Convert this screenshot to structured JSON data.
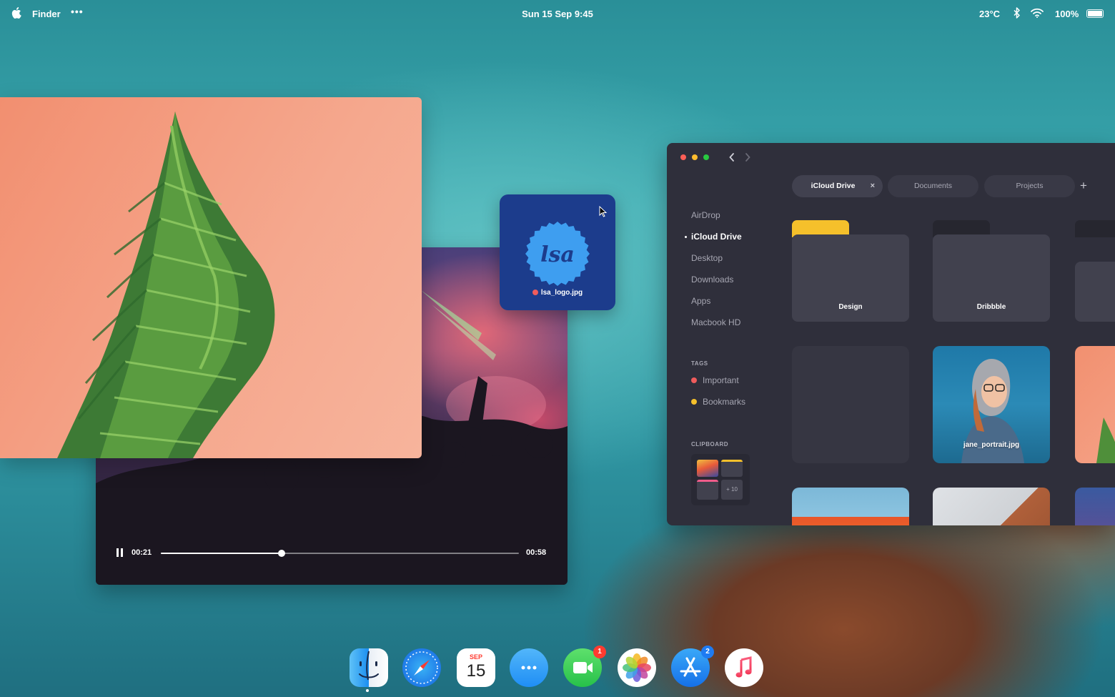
{
  "menubar": {
    "app_name": "Finder",
    "more": "•••",
    "datetime": "Sun 15 Sep 9:45",
    "temperature": "23°C",
    "battery": "100%",
    "battery_level": 1.0
  },
  "video": {
    "current_time": "00:21",
    "total_time": "00:58",
    "progress": 0.338,
    "state": "playing"
  },
  "drag_file": {
    "name": "lsa_logo.jpg",
    "logo_text": "lsa",
    "tag_color": "#ef5c5c"
  },
  "finder": {
    "tabs": [
      {
        "label": "iCloud Drive",
        "active": true,
        "close": "×"
      },
      {
        "label": "Documents",
        "active": false
      },
      {
        "label": "Projects",
        "active": false
      }
    ],
    "add_tab": "+",
    "sidebar": {
      "items": [
        {
          "label": "AirDrop"
        },
        {
          "label": "iCloud Drive",
          "active": true
        },
        {
          "label": "Desktop"
        },
        {
          "label": "Downloads"
        },
        {
          "label": "Apps"
        },
        {
          "label": "Macbook HD"
        }
      ],
      "tags_heading": "TAGS",
      "tags": [
        {
          "label": "Important",
          "color": "#ef5c5c"
        },
        {
          "label": "Bookmarks",
          "color": "#f5c02b"
        }
      ],
      "clipboard_heading": "CLIPBOARD",
      "clipboard_more": "+ 10"
    },
    "items": [
      {
        "label": "Design",
        "kind": "folder",
        "tab_color": "#f5c02b"
      },
      {
        "label": "Dribbble",
        "kind": "folder",
        "tab_color": "#26262f"
      },
      {
        "label": "",
        "kind": "folder"
      },
      {
        "label": "",
        "kind": "empty"
      },
      {
        "label": "jane_portrait.jpg",
        "kind": "image"
      },
      {
        "label": "",
        "kind": "image"
      },
      {
        "label": "",
        "kind": "image"
      },
      {
        "label": "",
        "kind": "image"
      },
      {
        "label": "",
        "kind": "image"
      }
    ]
  },
  "dock": {
    "apps": [
      {
        "name": "Finder",
        "icon": "finder-icon",
        "running": true
      },
      {
        "name": "Safari",
        "icon": "safari-compass-icon"
      },
      {
        "name": "Calendar",
        "icon": "calendar-icon",
        "month": "SEP",
        "day": "15"
      },
      {
        "name": "Messages",
        "icon": "messages-icon"
      },
      {
        "name": "FaceTime",
        "icon": "facetime-icon",
        "badge": "1"
      },
      {
        "name": "Photos",
        "icon": "photos-icon"
      },
      {
        "name": "App Store",
        "icon": "app-store-icon",
        "badge": "2"
      },
      {
        "name": "Music",
        "icon": "music-note-icon"
      }
    ]
  },
  "colors": {
    "finder_bg": "#2f2f3b",
    "accent_red": "#ff5f57",
    "accent_yellow": "#febc2e",
    "accent_green": "#28c840"
  }
}
